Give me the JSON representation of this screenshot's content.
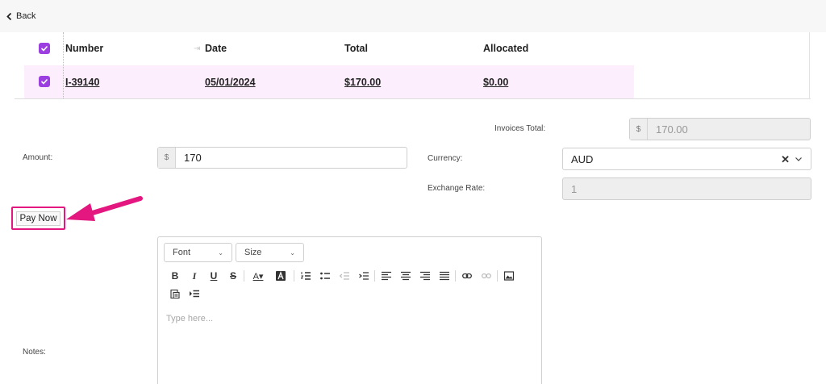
{
  "header": {
    "back_label": "Back"
  },
  "invoice_table": {
    "columns": [
      "Number",
      "Date",
      "Total",
      "Allocated"
    ],
    "rows": [
      {
        "number": "I-39140",
        "date": "05/01/2024",
        "total": "$170.00",
        "allocated": "$0.00",
        "checked": true
      }
    ],
    "header_checked": true
  },
  "form": {
    "invoices_total": {
      "label": "Invoices Total:",
      "prefix": "$",
      "value": "170.00"
    },
    "amount": {
      "label": "Amount:",
      "prefix": "$",
      "value": "170"
    },
    "currency": {
      "label": "Currency:",
      "value": "AUD"
    },
    "exchange_rate": {
      "label": "Exchange Rate:",
      "value": "1"
    },
    "pay_now_label": "Pay Now",
    "notes": {
      "label": "Notes:",
      "placeholder": "Type here..."
    }
  },
  "editor": {
    "font_label": "Font",
    "size_label": "Size",
    "toolbar_icons": [
      "bold-icon",
      "italic-icon",
      "underline-icon",
      "strikethrough-icon",
      "font-color-icon",
      "background-color-icon",
      "numbered-list-icon",
      "bulleted-list-icon",
      "decrease-indent-icon",
      "increase-indent-icon",
      "align-left-icon",
      "align-center-icon",
      "align-right-icon",
      "justify-icon",
      "link-icon",
      "unlink-icon",
      "image-icon",
      "paste-from-word-icon",
      "indent-block-icon"
    ]
  },
  "colors": {
    "accent_purple": "#9b3fe0",
    "highlight_pink": "#e3177f",
    "row_highlight": "#fdeefd"
  }
}
